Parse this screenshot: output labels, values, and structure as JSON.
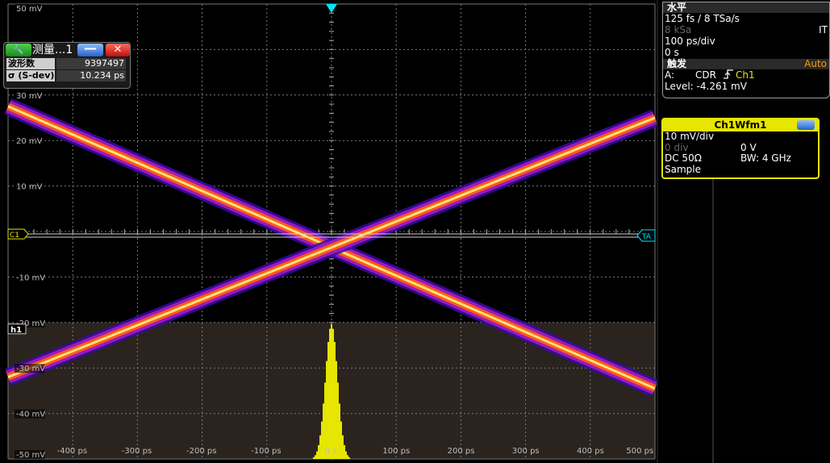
{
  "graph": {
    "y_labels": [
      "50 mV",
      "30 mV",
      "20 mV",
      "10 mV",
      "-10 mV",
      "-20 mV",
      "-30 mV",
      "-40 mV",
      "-50 mV"
    ],
    "x_labels": [
      "-400 ps",
      "-300 ps",
      "-200 ps",
      "-100 ps",
      "0 s",
      "100 ps",
      "200 ps",
      "300 ps",
      "400 ps",
      "500 ps"
    ],
    "ch_marker": "C1",
    "trigger_marker": "TA",
    "hist_marker": "h1",
    "colors": {
      "trace_core": "#ffe27a",
      "trace_mid": "#ff5a1a",
      "trace_outer": "#a01cc0",
      "trace_halo": "#3a0aa8",
      "histogram": "#e6e600",
      "grid": "#7a7a7a",
      "hist_bg": "#2a231e",
      "marker": "#00e5ff"
    }
  },
  "measure_window": {
    "title": "测量...1",
    "wrench_icon": "wrench-icon",
    "rows": [
      {
        "label": "波形数",
        "value": "9397497"
      },
      {
        "label": "σ (S-dev)",
        "value": "10.234 ps"
      }
    ]
  },
  "horizontal": {
    "title": "水平",
    "rate": "125 fs / 8 TSa/s",
    "tag": "IT",
    "samples": "8 kSa",
    "scale": "100 ps/div",
    "position": "0 s"
  },
  "trigger": {
    "title": "触发",
    "mode": "Auto",
    "source_label": "A:",
    "type": "CDR",
    "channel": "Ch1",
    "level": "Level: -4.261 mV"
  },
  "waveform": {
    "title": "Ch1Wfm1",
    "scale": "10 mV/div",
    "offset_div": "0 div",
    "offset_v": "0 V",
    "coupling": "DC 50Ω",
    "bandwidth": "BW: 4 GHz",
    "mode": "Sample"
  }
}
